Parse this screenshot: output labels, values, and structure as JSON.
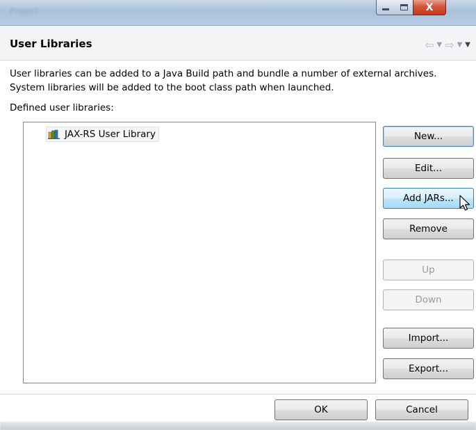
{
  "window": {
    "title": "Project",
    "controls": {
      "minimize": "minimize",
      "maximize": "maximize",
      "close": "X"
    }
  },
  "header": {
    "title": "User Libraries",
    "nav": {
      "back_icon": "back-arrow-icon",
      "forward_icon": "forward-arrow-icon"
    }
  },
  "description": "User libraries can be added to a Java Build path and bundle a number of external archives. System libraries will be added to the boot class path when launched.",
  "defined_label": "Defined user libraries:",
  "libraries": [
    {
      "name": "JAX-RS User Library",
      "icon": "library-icon"
    }
  ],
  "buttons": {
    "new": "New...",
    "edit": "Edit...",
    "add_jars": "Add JARs...",
    "remove": "Remove",
    "up": "Up",
    "down": "Down",
    "import": "Import...",
    "export": "Export..."
  },
  "footer": {
    "ok": "OK",
    "cancel": "Cancel"
  },
  "colors": {
    "accent": "#3c7fb1",
    "close": "#c3391f"
  }
}
